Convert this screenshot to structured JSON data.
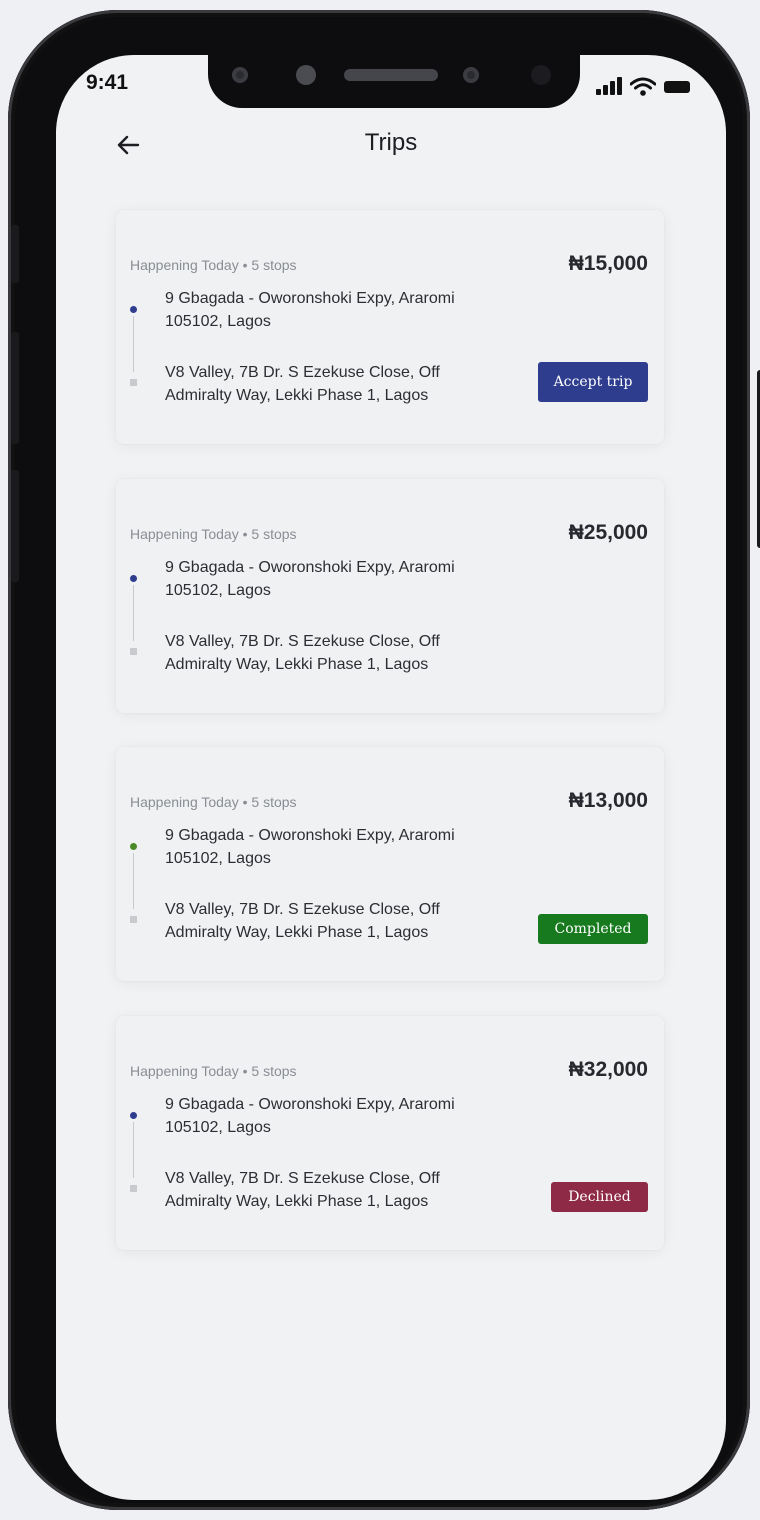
{
  "status_bar": {
    "time": "9:41"
  },
  "header": {
    "title": "Trips"
  },
  "colors": {
    "accent_blue": "#2f3d8f",
    "completed_green": "#177a1f",
    "declined_red": "#8e2946",
    "start_dot_blue": "#2f3d8f",
    "start_dot_green": "#4a8a2a"
  },
  "trips": [
    {
      "meta": "Happening Today • 5 stops",
      "price": "₦15,000",
      "from": "9 Gbagada - Oworonshoki Expy, Araromi 105102, Lagos",
      "to": "V8 Valley, 7B Dr. S Ezekuse Close, Off Admiralty Way, Lekki Phase 1, Lagos",
      "action": "Accept trip"
    },
    {
      "meta": "Happening Today • 5 stops",
      "price": "₦25,000",
      "from": "9 Gbagada - Oworonshoki Expy, Araromi 105102, Lagos",
      "to": "V8 Valley, 7B Dr. S Ezekuse Close, Off Admiralty Way, Lekki Phase 1, Lagos"
    },
    {
      "meta": "Happening Today • 5 stops",
      "price": "₦13,000",
      "from": "9 Gbagada - Oworonshoki Expy, Araromi 105102, Lagos",
      "to": "V8 Valley, 7B Dr. S Ezekuse Close, Off Admiralty Way, Lekki Phase 1, Lagos",
      "status": "Completed"
    },
    {
      "meta": "Happening Today • 5 stops",
      "price": "₦32,000",
      "from": "9 Gbagada - Oworonshoki Expy, Araromi 105102, Lagos",
      "to": "V8 Valley, 7B Dr. S Ezekuse Close, Off Admiralty Way, Lekki Phase 1, Lagos",
      "status": "Declined"
    }
  ],
  "icons": {
    "back": "arrow-left-icon",
    "signal": "cellular-signal-icon",
    "wifi": "wifi-icon",
    "battery": "battery-icon"
  }
}
